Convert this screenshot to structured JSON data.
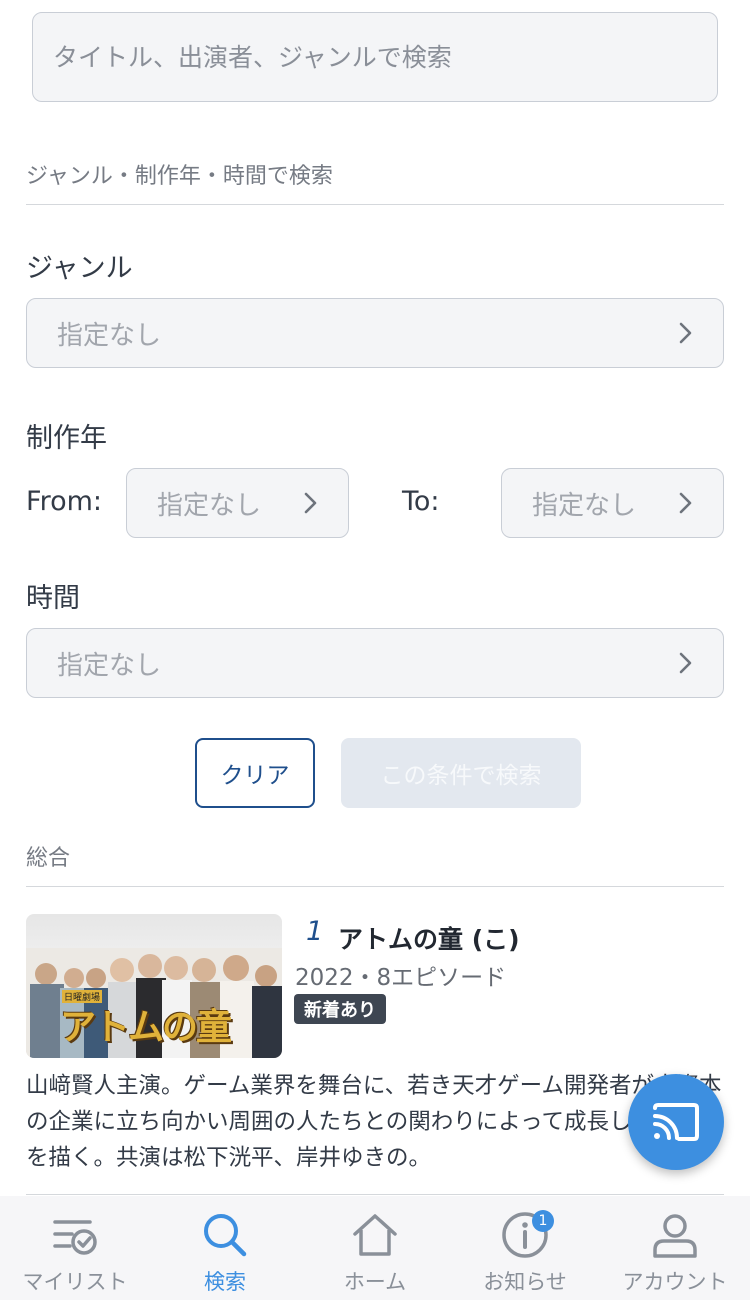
{
  "search": {
    "placeholder": "タイトル、出演者、ジャンルで検索"
  },
  "filter": {
    "section_title": "ジャンル・制作年・時間で検索",
    "genre": {
      "label": "ジャンル",
      "value": "指定なし"
    },
    "year": {
      "label": "制作年",
      "from_label": "From:",
      "from_value": "指定なし",
      "to_label": "To:",
      "to_value": "指定なし"
    },
    "duration": {
      "label": "時間",
      "value": "指定なし"
    },
    "clear_label": "クリア",
    "search_label": "この条件で検索"
  },
  "results": {
    "section_title": "総合",
    "items": [
      {
        "rank": "1",
        "title": "アトムの童 (こ)",
        "meta": "2022・8エピソード",
        "badge": "新着あり",
        "thumb_text": "アトムの童",
        "thumb_small": "日曜劇場",
        "description": "山﨑賢人主演。ゲーム業界を舞台に、若き天才ゲーム開発者が大資本の企業に立ち向かい周囲の人たちとの関わりによって成長していく姿を描く。共演は松下洸平、岸井ゆきの。"
      }
    ]
  },
  "tabbar": {
    "tabs": [
      {
        "label": "マイリスト",
        "icon": "mylist-icon",
        "active": false
      },
      {
        "label": "検索",
        "icon": "search-icon",
        "active": true
      },
      {
        "label": "ホーム",
        "icon": "home-icon",
        "active": false
      },
      {
        "label": "お知らせ",
        "icon": "info-icon",
        "active": false,
        "badge": "1"
      },
      {
        "label": "アカウント",
        "icon": "account-icon",
        "active": false
      }
    ]
  },
  "colors": {
    "accent": "#3d8fe0",
    "primary_dark": "#1f4f8c",
    "badge_bg": "#3e4652"
  }
}
